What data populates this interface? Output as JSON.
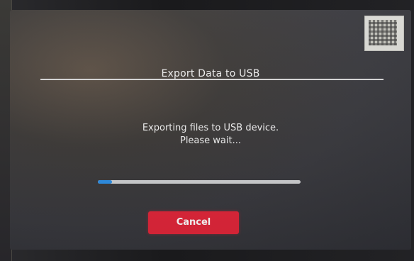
{
  "dialog": {
    "title": "Export Data to USB",
    "message_line1": "Exporting files to USB device.",
    "message_line2": "Please wait...",
    "progress_fraction": 0.07,
    "cancel_label": "Cancel"
  },
  "colors": {
    "accent_progress": "#2d8fe6",
    "cancel_button": "#e2263a"
  }
}
